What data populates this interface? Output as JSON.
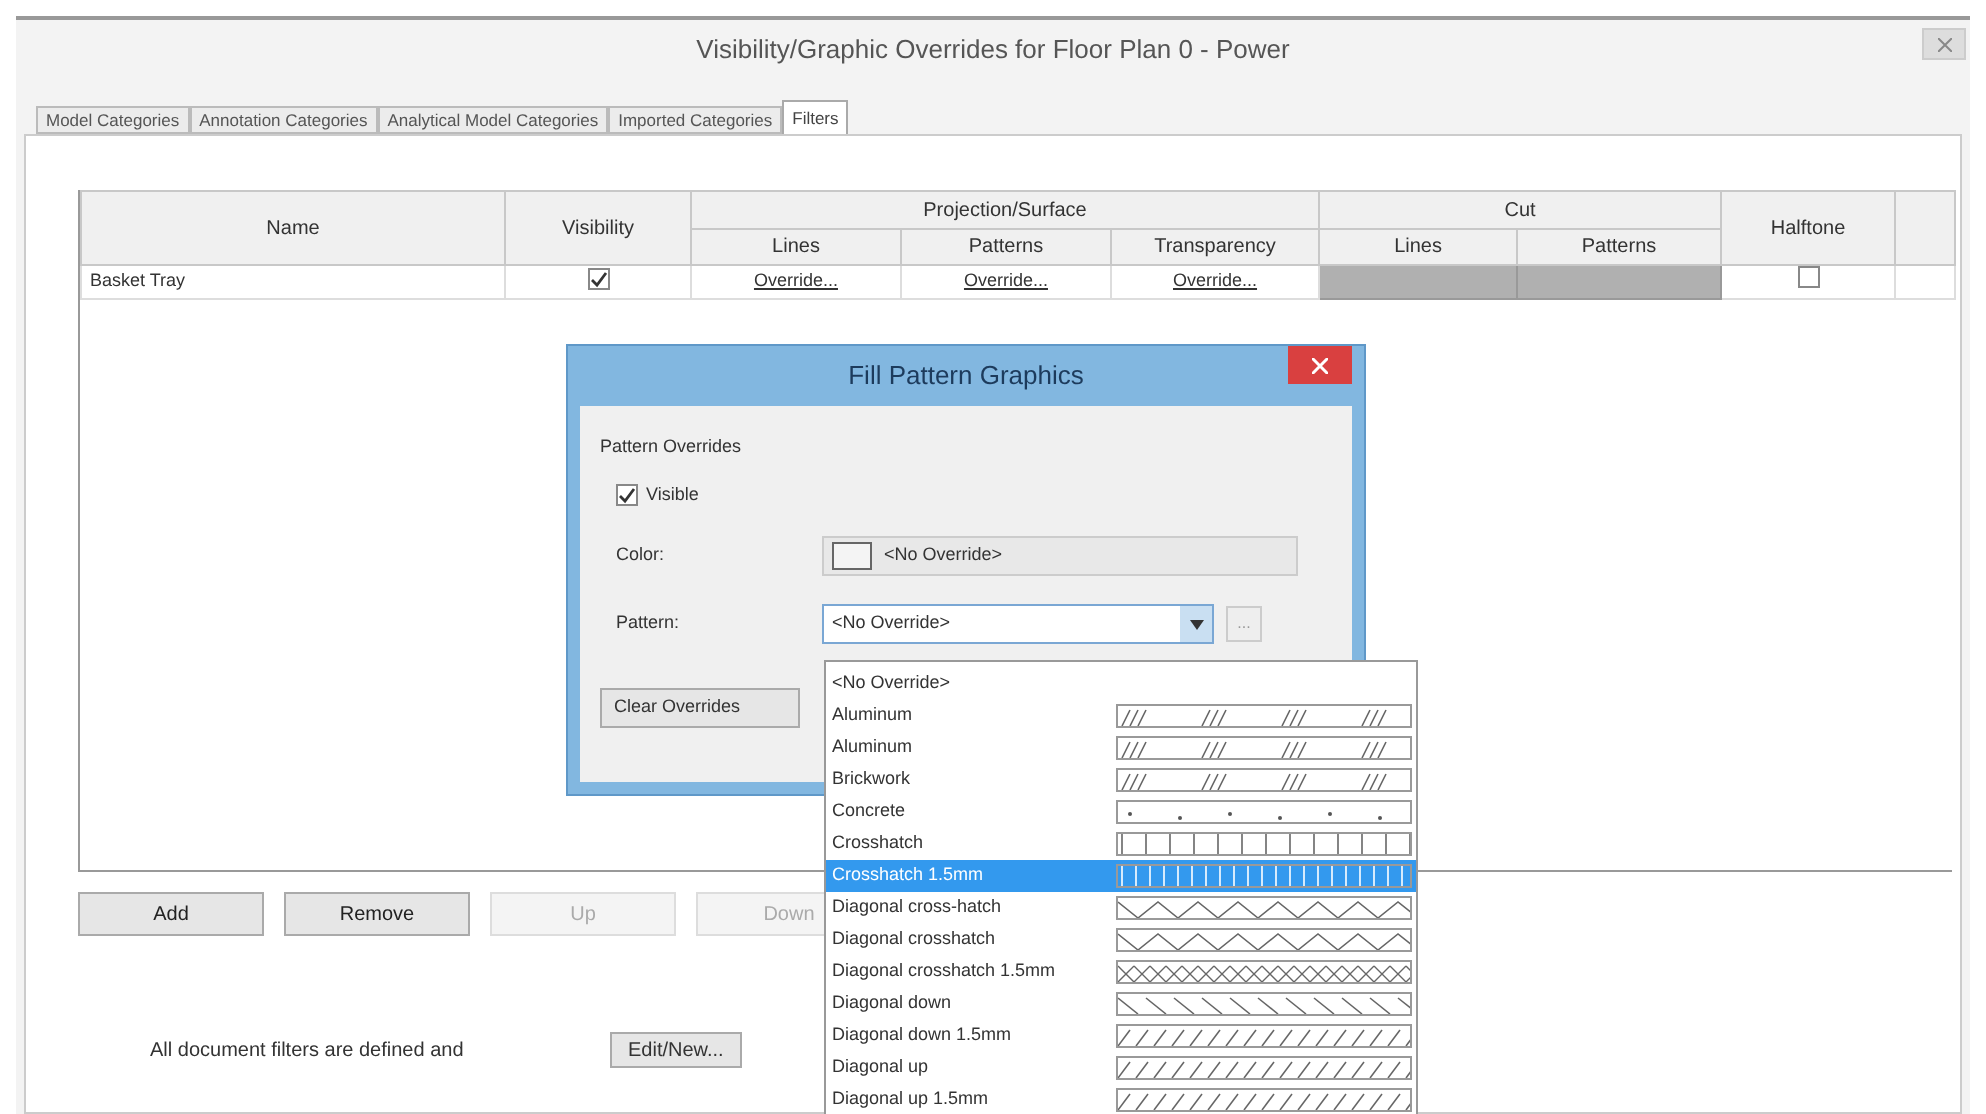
{
  "window": {
    "title": "Visibility/Graphic Overrides for Floor Plan 0 - Power"
  },
  "tabs": [
    {
      "label": "Model Categories",
      "selected": false
    },
    {
      "label": "Annotation Categories",
      "selected": false
    },
    {
      "label": "Analytical Model Categories",
      "selected": false
    },
    {
      "label": "Imported Categories",
      "selected": false
    },
    {
      "label": "Filters",
      "selected": true
    }
  ],
  "table": {
    "columns": {
      "name": "Name",
      "visibility": "Visibility",
      "projection": "Projection/Surface",
      "projection_lines": "Lines",
      "projection_patterns": "Patterns",
      "transparency": "Transparency",
      "cut": "Cut",
      "cut_lines": "Lines",
      "cut_patterns": "Patterns",
      "halftone": "Halftone"
    },
    "rows": [
      {
        "name": "Basket Tray",
        "visible": true,
        "lines": "Override...",
        "patterns": "Override...",
        "transparency": "Override...",
        "halftone": false
      }
    ]
  },
  "buttons": [
    {
      "label": "Add",
      "disabled": false
    },
    {
      "label": "Remove",
      "disabled": false
    },
    {
      "label": "Up",
      "disabled": true
    },
    {
      "label": "Down",
      "disabled": true
    }
  ],
  "footer": {
    "note": "All document filters are defined and",
    "button": "Edit/New..."
  },
  "dialog": {
    "title": "Fill Pattern Graphics",
    "group": "Pattern Overrides",
    "visible": {
      "label": "Visible",
      "checked": true
    },
    "color_label": "Color:",
    "color_value": "<No Override>",
    "pattern_label": "Pattern:",
    "pattern_value": "<No Override>",
    "browse": "...",
    "clear": "Clear Overrides"
  },
  "pattern_list": [
    {
      "label": "<No Override>",
      "kind": "none",
      "selected": false
    },
    {
      "label": "Aluminum",
      "kind": "dashes",
      "selected": false
    },
    {
      "label": "Aluminum",
      "kind": "dashes",
      "selected": false
    },
    {
      "label": "Brickwork",
      "kind": "dashes",
      "selected": false
    },
    {
      "label": "Concrete",
      "kind": "dots",
      "selected": false
    },
    {
      "label": "Crosshatch",
      "kind": "grid",
      "selected": false
    },
    {
      "label": "Crosshatch 1.5mm",
      "kind": "fine-grid",
      "selected": true
    },
    {
      "label": "Diagonal cross-hatch",
      "kind": "zigzag",
      "selected": false
    },
    {
      "label": "Diagonal crosshatch",
      "kind": "zigzag",
      "selected": false
    },
    {
      "label": "Diagonal crosshatch 1.5mm",
      "kind": "cross",
      "selected": false
    },
    {
      "label": "Diagonal down",
      "kind": "down",
      "selected": false
    },
    {
      "label": "Diagonal down 1.5mm",
      "kind": "up",
      "selected": false
    },
    {
      "label": "Diagonal up",
      "kind": "up",
      "selected": false
    },
    {
      "label": "Diagonal up 1.5mm",
      "kind": "up",
      "selected": false
    }
  ]
}
